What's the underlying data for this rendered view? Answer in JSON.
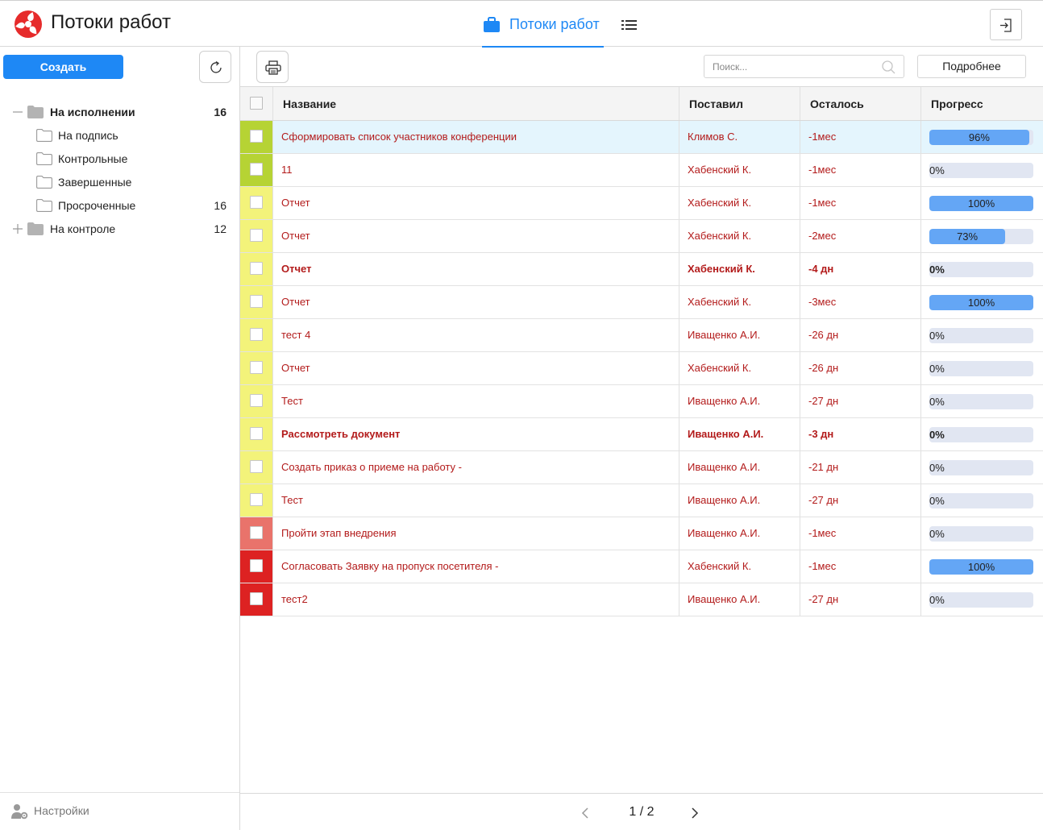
{
  "header": {
    "app_title": "Потоки работ",
    "tab_label": "Потоки работ",
    "icons": {
      "logo": "app-logo",
      "tab": "briefcase-icon",
      "list": "list-icon",
      "logout": "logout-icon"
    },
    "accent_color": "#1e88f5"
  },
  "sidebar": {
    "create_label": "Создать",
    "tree": [
      {
        "label": "На исполнении",
        "count": "16",
        "expanded": true
      },
      {
        "label": "На подпись",
        "count": ""
      },
      {
        "label": "Контрольные",
        "count": ""
      },
      {
        "label": "Завершенные",
        "count": ""
      },
      {
        "label": "Просроченные",
        "count": "16"
      },
      {
        "label": "На контроле",
        "count": "12",
        "expanded": false
      }
    ],
    "settings_label": "Настройки"
  },
  "toolbar": {
    "search_placeholder": "Поиск...",
    "more_label": "Подробнее"
  },
  "table": {
    "columns": [
      "Название",
      "Поставил",
      "Осталось",
      "Прогресс"
    ],
    "rows": [
      {
        "status_color": "#b6d334",
        "name": "Сформировать список участников конференции",
        "by": "Климов С.",
        "left": "-1мес",
        "progress": "96%",
        "progress_value": 96,
        "bold": false,
        "selected": true
      },
      {
        "status_color": "#b6d334",
        "name": "11",
        "by": "Хабенский К.",
        "left": "-1мес",
        "progress": "0%",
        "progress_value": 0,
        "bold": false
      },
      {
        "status_color": "#f3f37a",
        "name": "Отчет",
        "by": "Хабенский К.",
        "left": "-1мес",
        "progress": "100%",
        "progress_value": 100,
        "bold": false
      },
      {
        "status_color": "#f3f37a",
        "name": "Отчет",
        "by": "Хабенский К.",
        "left": "-2мес",
        "progress": "73%",
        "progress_value": 73,
        "bold": false
      },
      {
        "status_color": "#f3f37a",
        "name": "Отчет",
        "by": "Хабенский К.",
        "left": "-4 дн",
        "progress": "0%",
        "progress_value": 0,
        "bold": true
      },
      {
        "status_color": "#f3f37a",
        "name": "Отчет",
        "by": "Хабенский К.",
        "left": "-3мес",
        "progress": "100%",
        "progress_value": 100,
        "bold": false
      },
      {
        "status_color": "#f3f37a",
        "name": "тест 4",
        "by": "Иващенко А.И.",
        "left": "-26 дн",
        "progress": "0%",
        "progress_value": 0,
        "bold": false
      },
      {
        "status_color": "#f3f37a",
        "name": "Отчет",
        "by": "Хабенский К.",
        "left": "-26 дн",
        "progress": "0%",
        "progress_value": 0,
        "bold": false
      },
      {
        "status_color": "#f3f37a",
        "name": "Тест",
        "by": "Иващенко А.И.",
        "left": "-27 дн",
        "progress": "0%",
        "progress_value": 0,
        "bold": false
      },
      {
        "status_color": "#f3f37a",
        "name": "Рассмотреть документ",
        "by": "Иващенко А.И.",
        "left": "-3 дн",
        "progress": "0%",
        "progress_value": 0,
        "bold": true
      },
      {
        "status_color": "#f3f37a",
        "name": "Создать приказ о приеме на работу -",
        "by": "Иващенко А.И.",
        "left": "-21 дн",
        "progress": "0%",
        "progress_value": 0,
        "bold": false
      },
      {
        "status_color": "#f3f37a",
        "name": "Тест",
        "by": "Иващенко А.И.",
        "left": "-27 дн",
        "progress": "0%",
        "progress_value": 0,
        "bold": false
      },
      {
        "status_color": "#e9736b",
        "name": "Пройти этап внедрения",
        "by": "Иващенко А.И.",
        "left": "-1мес",
        "progress": "0%",
        "progress_value": 0,
        "bold": false
      },
      {
        "status_color": "#dd2222",
        "name": "Согласовать Заявку на пропуск посетителя -",
        "by": "Хабенский К.",
        "left": "-1мес",
        "progress": "100%",
        "progress_value": 100,
        "bold": false
      },
      {
        "status_color": "#dd2222",
        "name": "тест2",
        "by": "Иващенко А.И.",
        "left": "-27 дн",
        "progress": "0%",
        "progress_value": 0,
        "bold": false
      }
    ]
  },
  "pagination": {
    "text": "1 / 2"
  }
}
